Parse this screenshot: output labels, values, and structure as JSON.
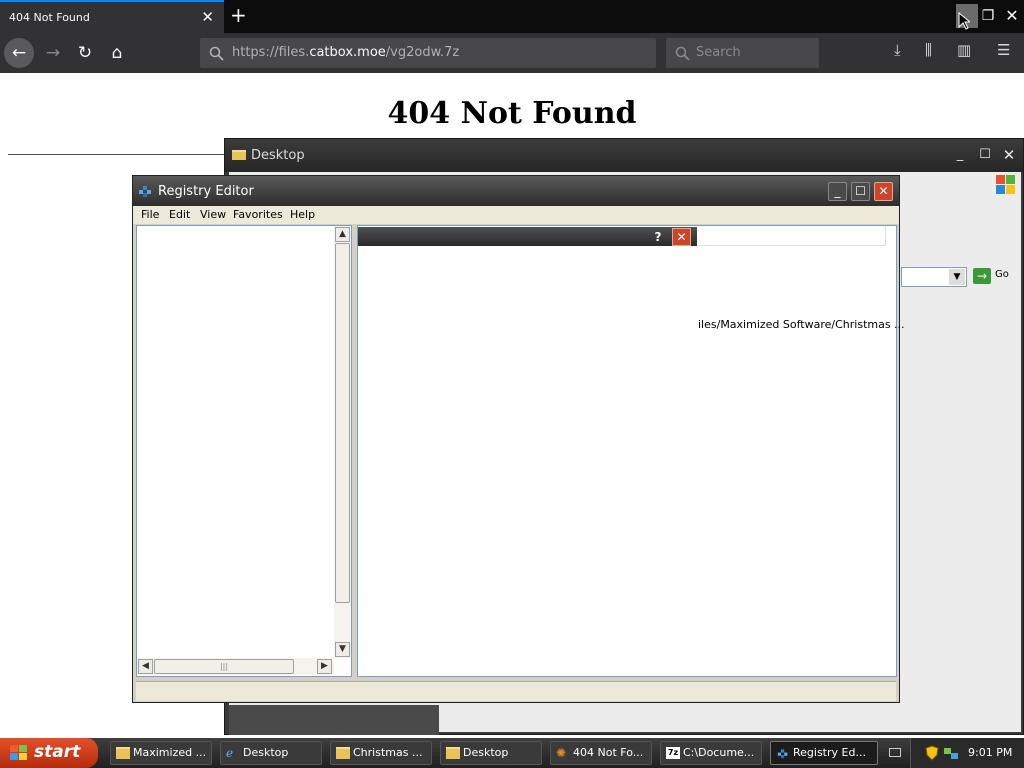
{
  "browser": {
    "tab_title": "404 Not Found",
    "url_prefix": "https://files.",
    "url_domain": "catbox.moe",
    "url_path": "/vg2odw.7z",
    "search_placeholder": "Search"
  },
  "page": {
    "heading": "404 Not Found"
  },
  "desktop_window": {
    "title": "Desktop",
    "go_label": "Go"
  },
  "registry_editor": {
    "title": "Registry Editor",
    "menu": [
      "File",
      "Edit",
      "View",
      "Favorites",
      "Help"
    ],
    "dialog_help": "?",
    "path_text": "iles/Maximized Software/Christmas ..."
  },
  "taskbar": {
    "start_label": "start",
    "items": [
      {
        "label": "Maximized ...",
        "icon": "folder-icon"
      },
      {
        "label": "Desktop",
        "icon": "ie-icon"
      },
      {
        "label": "Christmas ...",
        "icon": "folder-icon"
      },
      {
        "label": "Desktop",
        "icon": "folder-icon"
      },
      {
        "label": "404 Not Fo...",
        "icon": "firefox-icon"
      },
      {
        "label": "C:\\Docume...",
        "icon": "7zip-icon"
      },
      {
        "label": "Registry Ed...",
        "icon": "regedit-icon"
      }
    ],
    "clock": "9:01 PM"
  },
  "colors": {
    "accent": "#0a84ff",
    "start_button": "#c83a16",
    "close_button": "#c8462a"
  }
}
